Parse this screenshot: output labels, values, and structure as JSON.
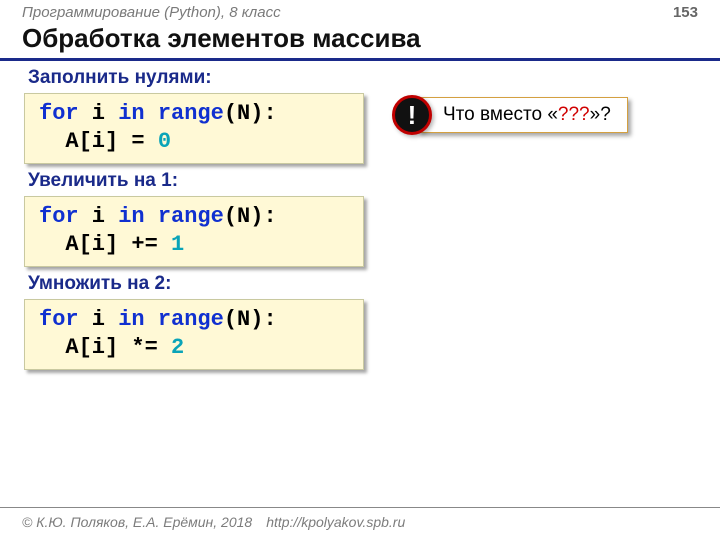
{
  "header": {
    "course": "Программирование (Python), 8 класс",
    "page": "153"
  },
  "title": "Обработка элементов массива",
  "sections": [
    {
      "heading": "Заполнить нулями:",
      "code": {
        "l1_kw1": "for",
        "l1_p1": " i ",
        "l1_kw2": "in",
        "l1_p2": " ",
        "l1_kw3": "range",
        "l1_p3": "(N):",
        "l2_p1": "  A[i] = ",
        "l2_num": "0"
      }
    },
    {
      "heading": "Увеличить на 1:",
      "code": {
        "l1_kw1": "for",
        "l1_p1": " i ",
        "l1_kw2": "in",
        "l1_p2": " ",
        "l1_kw3": "range",
        "l1_p3": "(N):",
        "l2_p1": "  A[i] += ",
        "l2_num": "1"
      }
    },
    {
      "heading": "Умножить на 2:",
      "code": {
        "l1_kw1": "for",
        "l1_p1": " i ",
        "l1_kw2": "in",
        "l1_p2": " ",
        "l1_kw3": "range",
        "l1_p3": "(N):",
        "l2_p1": "  A[i] *= ",
        "l2_num": "2"
      }
    }
  ],
  "callout": {
    "bang": "!",
    "text_before": "Что вместо «",
    "text_red": "???",
    "text_after": "»?"
  },
  "footer": {
    "copyright": "© К.Ю. Поляков, Е.А. Ерёмин, 2018",
    "url": "http://kpolyakov.spb.ru"
  }
}
